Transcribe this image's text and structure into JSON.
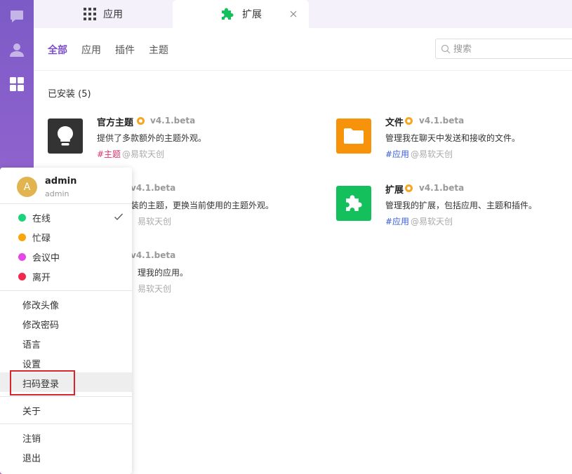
{
  "tabs": {
    "apps": {
      "label": "应用"
    },
    "extensions": {
      "label": "扩展"
    }
  },
  "filters": [
    "全部",
    "应用",
    "插件",
    "主题"
  ],
  "search": {
    "placeholder": "搜索"
  },
  "installed": {
    "title": "已安装 (5)"
  },
  "cards": [
    {
      "name": "官方主题",
      "version": "v4.1.beta",
      "description": "提供了多款额外的主题外观。",
      "tag": "#主题",
      "author": "@易软天创",
      "icon": "lightbulb-icon",
      "icon_bg": "#333333",
      "tag_color": "#e0306a"
    },
    {
      "name": "文件",
      "version": "v4.1.beta",
      "description": "管理我在聊天中发送和接收的文件。",
      "tag": "#应用",
      "author": "@易软天创",
      "icon": "folder-icon",
      "icon_bg": "#f7930a",
      "tag_color": "#3b5dd4"
    },
    {
      "version": "v4.1.beta",
      "description": "装的主题，更换当前使用的主题外观。",
      "author": "易软天创"
    },
    {
      "name": "扩展",
      "version": "v4.1.beta",
      "description": "管理我的扩展，包括应用、主题和插件。",
      "tag": "#应用",
      "author": "@易软天创",
      "icon": "puzzle-icon",
      "icon_bg": "#13c05c",
      "tag_color": "#3b5dd4"
    },
    {
      "version": "v4.1.beta",
      "description": "理我的应用。",
      "author": "易软天创"
    }
  ],
  "user": {
    "initial": "A",
    "name": "admin",
    "account": "admin"
  },
  "statuses": [
    {
      "label": "在线",
      "color": "#1bd37a",
      "selected": true
    },
    {
      "label": "忙碌",
      "color": "#f9a60a",
      "selected": false
    },
    {
      "label": "会议中",
      "color": "#e648e6",
      "selected": false
    },
    {
      "label": "离开",
      "color": "#f0284d",
      "selected": false
    }
  ],
  "menu": {
    "change_avatar": "修改头像",
    "change_password": "修改密码",
    "language": "语言",
    "settings": "设置",
    "scan_login": "扫码登录",
    "about": "关于",
    "logout": "注销",
    "exit": "退出"
  }
}
